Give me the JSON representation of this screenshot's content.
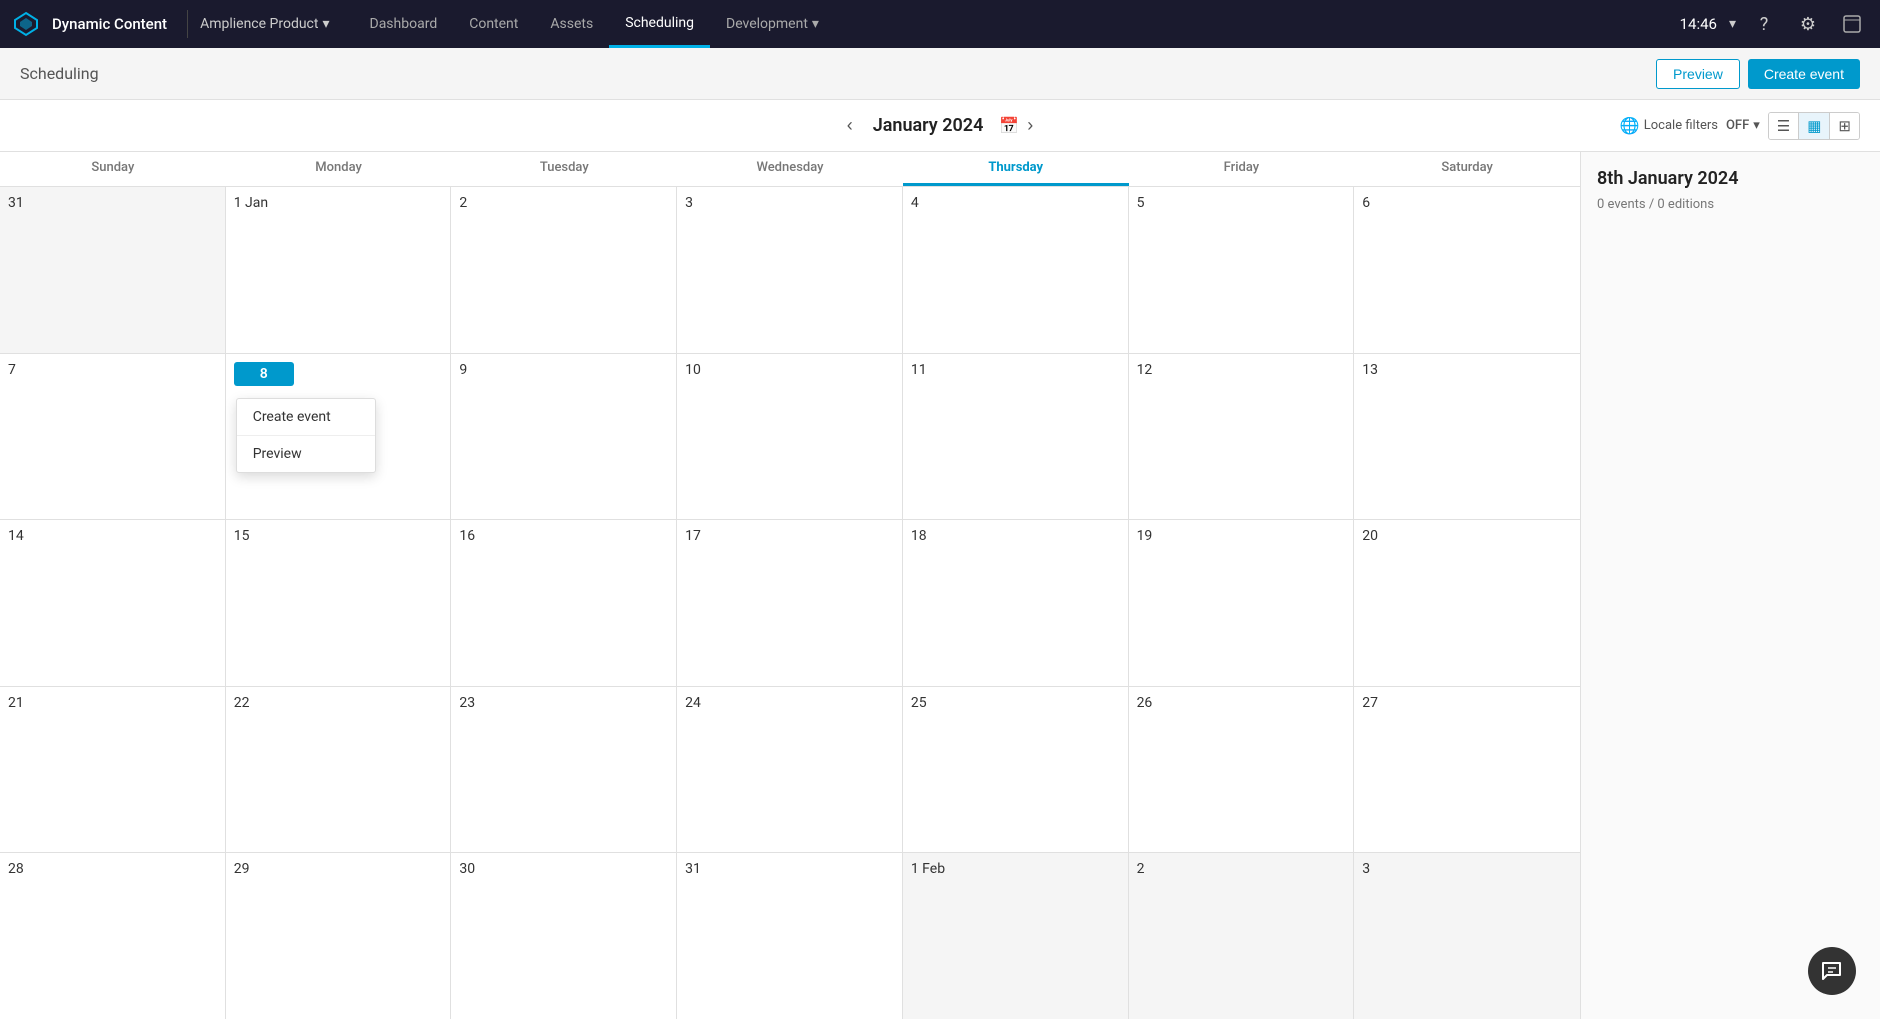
{
  "app": {
    "name": "Dynamic Content",
    "logo_symbol": "◇"
  },
  "nav": {
    "product": "Amplience Product",
    "links": [
      {
        "label": "Dashboard",
        "active": false
      },
      {
        "label": "Content",
        "active": false
      },
      {
        "label": "Assets",
        "active": false
      },
      {
        "label": "Scheduling",
        "active": true
      },
      {
        "label": "Development",
        "active": false
      }
    ],
    "time": "14:46",
    "chevron_icon": "▾",
    "help_icon": "?",
    "settings_icon": "⚙",
    "person_icon": "👤"
  },
  "sub_header": {
    "title": "Scheduling",
    "btn_preview": "Preview",
    "btn_create": "Create event"
  },
  "calendar": {
    "month_label": "January 2024",
    "prev_icon": "‹",
    "next_icon": "›",
    "calendar_icon": "📅",
    "locale_filter_label": "Locale filters",
    "locale_filter_value": "OFF",
    "days_of_week": [
      {
        "label": "Sunday",
        "today": false
      },
      {
        "label": "Monday",
        "today": false
      },
      {
        "label": "Tuesday",
        "today": false
      },
      {
        "label": "Wednesday",
        "today": false
      },
      {
        "label": "Thursday",
        "today": true
      },
      {
        "label": "Friday",
        "today": false
      },
      {
        "label": "Saturday",
        "today": false
      }
    ],
    "weeks": [
      [
        {
          "num": "31",
          "other": true
        },
        {
          "num": "1 Jan",
          "other": false
        },
        {
          "num": "2",
          "other": false
        },
        {
          "num": "3",
          "other": false
        },
        {
          "num": "4",
          "other": false
        },
        {
          "num": "5",
          "other": false
        },
        {
          "num": "6",
          "other": false
        }
      ],
      [
        {
          "num": "7",
          "other": false
        },
        {
          "num": "8",
          "other": false,
          "selected": true,
          "context_menu": true
        },
        {
          "num": "9",
          "other": false
        },
        {
          "num": "10",
          "other": false
        },
        {
          "num": "11",
          "other": false
        },
        {
          "num": "12",
          "other": false
        },
        {
          "num": "13",
          "other": false
        }
      ],
      [
        {
          "num": "14",
          "other": false
        },
        {
          "num": "15",
          "other": false
        },
        {
          "num": "16",
          "other": false
        },
        {
          "num": "17",
          "other": false
        },
        {
          "num": "18",
          "other": false
        },
        {
          "num": "19",
          "other": false
        },
        {
          "num": "20",
          "other": false
        }
      ],
      [
        {
          "num": "21",
          "other": false
        },
        {
          "num": "22",
          "other": false
        },
        {
          "num": "23",
          "other": false
        },
        {
          "num": "24",
          "other": false
        },
        {
          "num": "25",
          "other": false
        },
        {
          "num": "26",
          "other": false
        },
        {
          "num": "27",
          "other": false
        }
      ],
      [
        {
          "num": "28",
          "other": false
        },
        {
          "num": "29",
          "other": false
        },
        {
          "num": "30",
          "other": false
        },
        {
          "num": "31",
          "other": false
        },
        {
          "num": "1 Feb",
          "other": true
        },
        {
          "num": "2",
          "other": true
        },
        {
          "num": "3",
          "other": true
        }
      ]
    ],
    "context_menu": {
      "items": [
        "Create event",
        "Preview"
      ]
    }
  },
  "sidebar": {
    "date_title": "8th January 2024",
    "events_label": "0 events / 0 editions"
  },
  "view_buttons": [
    {
      "icon": "☰",
      "active": false
    },
    {
      "icon": "▦",
      "active": true
    },
    {
      "icon": "⊞",
      "active": false
    }
  ]
}
